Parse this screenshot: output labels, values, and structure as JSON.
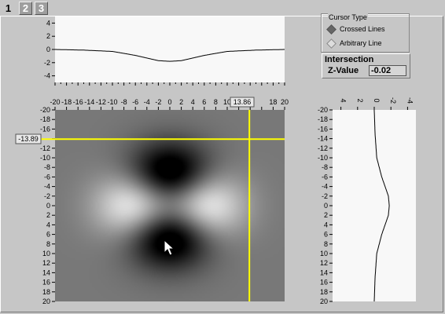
{
  "tabs": [
    {
      "label": "1",
      "active": true
    },
    {
      "label": "2",
      "active": false
    },
    {
      "label": "3",
      "active": false
    }
  ],
  "cursor_type": {
    "title": "Cursor Type",
    "options": [
      {
        "label": "Crossed Lines",
        "selected": true
      },
      {
        "label": "Arbitrary Line",
        "selected": false
      }
    ]
  },
  "intersection": {
    "title": "Intersection",
    "z_label": "Z-Value",
    "z_value": "-0.02"
  },
  "cursor": {
    "x_readout": "13.86",
    "y_readout": "-13.89",
    "x": 13.86,
    "y": -13.89
  },
  "colors": {
    "cursor_line": "#ffff00",
    "plot_background": "#f8f8f8",
    "panel_background": "#c6c6c6"
  },
  "chart_data": [
    {
      "type": "line",
      "role": "horizontal-profile",
      "xlim": [
        -20,
        20
      ],
      "ylim": [
        -5,
        5
      ],
      "ytick_labels": [
        "4",
        "2",
        "0",
        "-2",
        "-4"
      ],
      "x": [
        -20,
        -15,
        -10,
        -6,
        -4,
        -2,
        0,
        2,
        4,
        6,
        10,
        15,
        20
      ],
      "y": [
        0.0,
        -0.1,
        -0.3,
        -0.9,
        -1.3,
        -1.7,
        -1.8,
        -1.7,
        -1.3,
        -0.9,
        -0.3,
        -0.1,
        0.0
      ]
    },
    {
      "type": "heatmap",
      "role": "image-map",
      "xlim": [
        -20,
        20
      ],
      "ylim": [
        -20,
        20
      ],
      "xtick_labels": [
        "-20",
        "-18",
        "-16",
        "-14",
        "-12",
        "-10",
        "-8",
        "-6",
        "-4",
        "-2",
        "0",
        "2",
        "4",
        "6",
        "8",
        "10",
        "12",
        "14",
        "16",
        "18",
        "20"
      ],
      "ytick_labels": [
        "-20",
        "-18",
        "-16",
        "-14",
        "-12",
        "-10",
        "-8",
        "-6",
        "-4",
        "-2",
        "0",
        "2",
        "4",
        "6",
        "8",
        "10",
        "12",
        "14",
        "16",
        "18",
        "20"
      ]
    },
    {
      "type": "line",
      "role": "vertical-profile",
      "xlim": [
        -5,
        5
      ],
      "ylim": [
        -20,
        20
      ],
      "xtick_labels": [
        "4",
        "2",
        "0",
        "-2",
        "-4"
      ],
      "ytick_labels": [
        "-20",
        "-18",
        "-16",
        "-14",
        "-12",
        "-10",
        "-8",
        "-6",
        "-4",
        "-2",
        "0",
        "2",
        "4",
        "6",
        "8",
        "10",
        "12",
        "14",
        "16",
        "18",
        "20"
      ],
      "y": [
        -20,
        -15,
        -10,
        -6,
        -4,
        -2,
        0,
        2,
        4,
        6,
        10,
        15,
        20
      ],
      "x": [
        0.0,
        0.1,
        0.3,
        0.9,
        1.3,
        1.7,
        1.8,
        1.7,
        1.3,
        0.9,
        0.3,
        0.1,
        0.0
      ]
    }
  ]
}
